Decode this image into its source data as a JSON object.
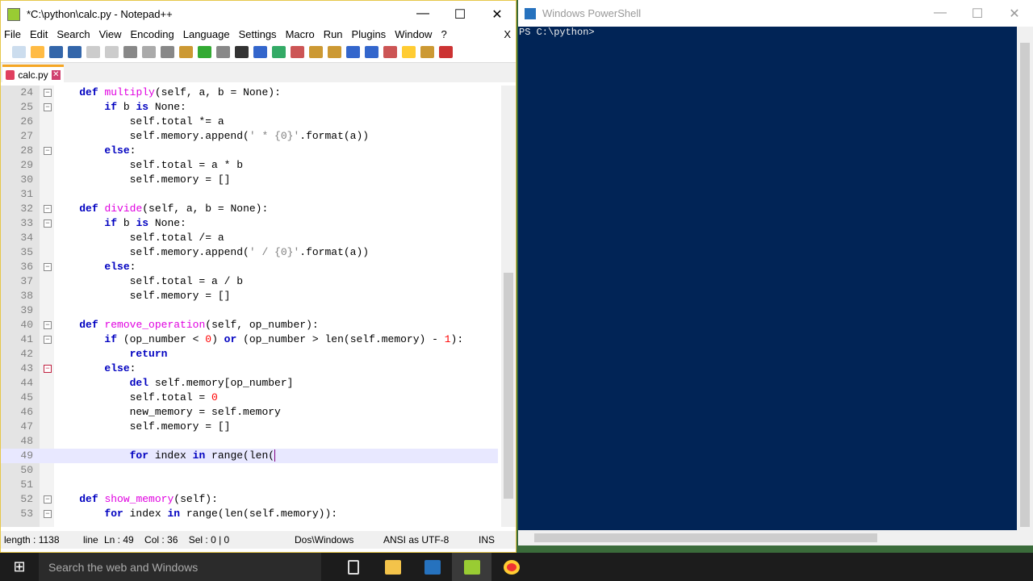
{
  "notepad": {
    "title": "*C:\\python\\calc.py - Notepad++",
    "menu": [
      "File",
      "Edit",
      "Search",
      "View",
      "Encoding",
      "Language",
      "Settings",
      "Macro",
      "Run",
      "Plugins",
      "Window",
      "?"
    ],
    "menu_close": "X",
    "tab": "calc.py",
    "status": {
      "length": "length : 1138",
      "lines": "line",
      "pos": "Ln : 49    Col : 36    Sel : 0 | 0",
      "eol": "Dos\\Windows",
      "enc": "ANSI as UTF-8",
      "mode": "INS"
    }
  },
  "code": [
    {
      "n": "24",
      "fold": "box",
      "t": [
        [
          "    "
        ],
        [
          "def",
          "k"
        ],
        [
          " "
        ],
        [
          "multiply",
          "f"
        ],
        [
          "(self, a, b = None):"
        ]
      ]
    },
    {
      "n": "25",
      "fold": "box",
      "t": [
        [
          "        "
        ],
        [
          "if",
          "k"
        ],
        [
          " b "
        ],
        [
          "is",
          "k"
        ],
        [
          " None:"
        ]
      ]
    },
    {
      "n": "26",
      "t": [
        [
          "            self.total *= a"
        ]
      ]
    },
    {
      "n": "27",
      "t": [
        [
          "            self.memory.append("
        ],
        [
          "' * {0}'",
          "s"
        ],
        [
          ".format(a))"
        ]
      ]
    },
    {
      "n": "28",
      "fold": "box",
      "t": [
        [
          "        "
        ],
        [
          "else",
          "k"
        ],
        [
          ":"
        ]
      ]
    },
    {
      "n": "29",
      "t": [
        [
          "            self.total = a * b"
        ]
      ]
    },
    {
      "n": "30",
      "t": [
        [
          "            self.memory = []"
        ]
      ]
    },
    {
      "n": "31",
      "t": []
    },
    {
      "n": "32",
      "fold": "box",
      "t": [
        [
          "    "
        ],
        [
          "def",
          "k"
        ],
        [
          " "
        ],
        [
          "divide",
          "f"
        ],
        [
          "(self, a, b = None):"
        ]
      ]
    },
    {
      "n": "33",
      "fold": "box",
      "t": [
        [
          "        "
        ],
        [
          "if",
          "k"
        ],
        [
          " b "
        ],
        [
          "is",
          "k"
        ],
        [
          " None:"
        ]
      ]
    },
    {
      "n": "34",
      "t": [
        [
          "            self.total /= a"
        ]
      ]
    },
    {
      "n": "35",
      "t": [
        [
          "            self.memory.append("
        ],
        [
          "' / {0}'",
          "s"
        ],
        [
          ".format(a))"
        ]
      ]
    },
    {
      "n": "36",
      "fold": "box",
      "t": [
        [
          "        "
        ],
        [
          "else",
          "k"
        ],
        [
          ":"
        ]
      ]
    },
    {
      "n": "37",
      "t": [
        [
          "            self.total = a / b"
        ]
      ]
    },
    {
      "n": "38",
      "t": [
        [
          "            self.memory = []"
        ]
      ]
    },
    {
      "n": "39",
      "t": []
    },
    {
      "n": "40",
      "fold": "box",
      "t": [
        [
          "    "
        ],
        [
          "def",
          "k"
        ],
        [
          " "
        ],
        [
          "remove_operation",
          "f"
        ],
        [
          "(self, op_number):"
        ]
      ]
    },
    {
      "n": "41",
      "fold": "box",
      "t": [
        [
          "        "
        ],
        [
          "if",
          "k"
        ],
        [
          " (op_number < "
        ],
        [
          "0",
          "n"
        ],
        [
          ") "
        ],
        [
          "or",
          "k"
        ],
        [
          " (op_number > len(self.memory) - "
        ],
        [
          "1",
          "n"
        ],
        [
          "):"
        ]
      ]
    },
    {
      "n": "42",
      "t": [
        [
          "            "
        ],
        [
          "return",
          "k"
        ]
      ]
    },
    {
      "n": "43",
      "fold": "red",
      "t": [
        [
          "        "
        ],
        [
          "else",
          "k"
        ],
        [
          ":"
        ]
      ]
    },
    {
      "n": "44",
      "t": [
        [
          "            "
        ],
        [
          "del",
          "k"
        ],
        [
          " self.memory[op_number]"
        ]
      ]
    },
    {
      "n": "45",
      "t": [
        [
          "            self.total = "
        ],
        [
          "0",
          "n"
        ]
      ]
    },
    {
      "n": "46",
      "t": [
        [
          "            new_memory = self.memory"
        ]
      ]
    },
    {
      "n": "47",
      "t": [
        [
          "            self.memory = []"
        ]
      ]
    },
    {
      "n": "48",
      "t": []
    },
    {
      "n": "49",
      "cur": true,
      "t": [
        [
          "            "
        ],
        [
          "for",
          "k"
        ],
        [
          " index "
        ],
        [
          "in",
          "k"
        ],
        [
          " range(len("
        ]
      ]
    },
    {
      "n": "50",
      "t": []
    },
    {
      "n": "51",
      "t": []
    },
    {
      "n": "52",
      "fold": "box",
      "t": [
        [
          "    "
        ],
        [
          "def",
          "k"
        ],
        [
          " "
        ],
        [
          "show_memory",
          "f"
        ],
        [
          "(self):"
        ]
      ]
    },
    {
      "n": "53",
      "fold": "box",
      "t": [
        [
          "        "
        ],
        [
          "for",
          "k"
        ],
        [
          " index "
        ],
        [
          "in",
          "k"
        ],
        [
          " range(len(self.memory)):"
        ]
      ]
    }
  ],
  "powershell": {
    "title": "Windows PowerShell",
    "prompt": "PS C:\\python>"
  },
  "taskbar": {
    "search": "Search the web and Windows"
  }
}
